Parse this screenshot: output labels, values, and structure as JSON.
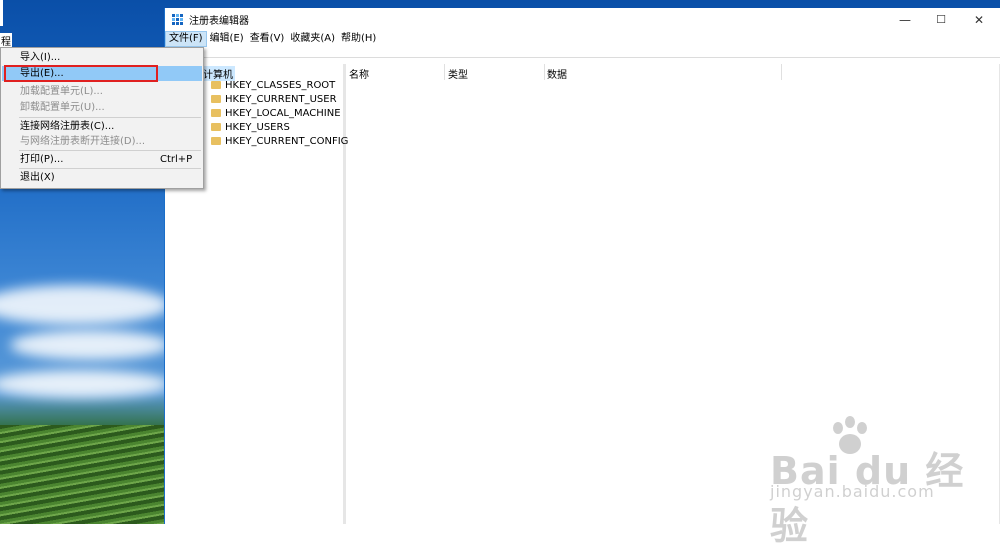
{
  "desktop": {
    "label": "程"
  },
  "window": {
    "title": "注册表编辑器",
    "controls": {
      "minimize": "—",
      "maximize": "☐",
      "close": "✕"
    }
  },
  "menubar": [
    {
      "label": "文件(F)"
    },
    {
      "label": "编辑(E)"
    },
    {
      "label": "查看(V)"
    },
    {
      "label": "收藏夹(A)"
    },
    {
      "label": "帮助(H)"
    }
  ],
  "tree": {
    "root": "计算机",
    "nodes": [
      "HKEY_CLASSES_ROOT",
      "HKEY_CURRENT_USER",
      "HKEY_LOCAL_MACHINE",
      "HKEY_USERS",
      "HKEY_CURRENT_CONFIG"
    ]
  },
  "list_columns": [
    "名称",
    "类型",
    "数据"
  ],
  "file_menu": {
    "items": [
      {
        "label": "导入(I)...",
        "shortcut": "",
        "disabled": false
      },
      {
        "label": "导出(E)...",
        "shortcut": "",
        "disabled": false,
        "highlighted": true
      },
      {
        "label": "加载配置单元(L)...",
        "shortcut": "",
        "disabled": true
      },
      {
        "label": "卸载配置单元(U)...",
        "shortcut": "",
        "disabled": true
      },
      {
        "label": "连接网络注册表(C)...",
        "shortcut": "",
        "disabled": false
      },
      {
        "label": "与网络注册表断开连接(D)...",
        "shortcut": "",
        "disabled": true
      },
      {
        "label": "打印(P)...",
        "shortcut": "Ctrl+P",
        "disabled": false
      },
      {
        "label": "退出(X)",
        "shortcut": "",
        "disabled": false
      }
    ]
  },
  "watermark": {
    "brand": "Bai du 经验",
    "url": "jingyan.baidu.com"
  },
  "colors": {
    "accent": "#1565c0",
    "menu_hover": "#91c9f7",
    "highlight_box": "#e02020",
    "selection": "#cce8ff"
  }
}
